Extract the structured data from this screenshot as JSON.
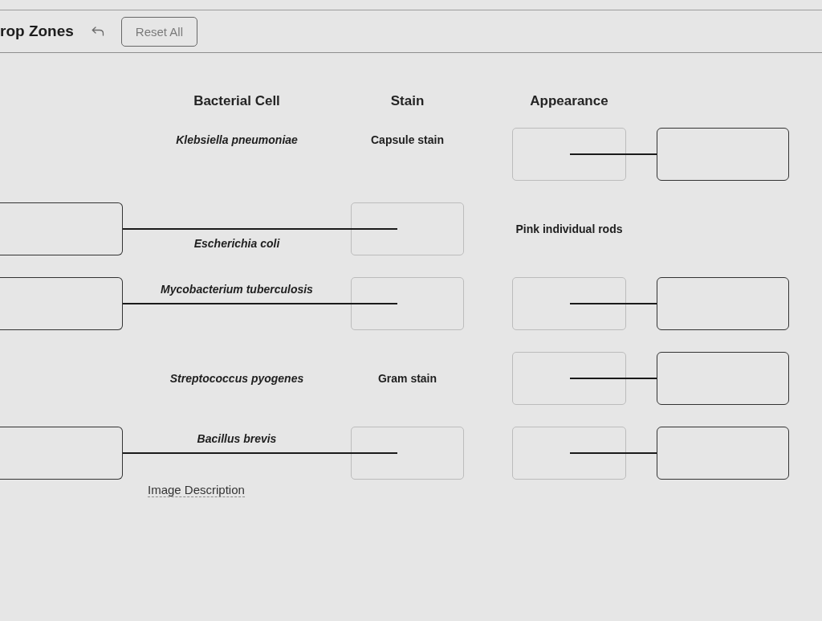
{
  "toolbar": {
    "title": "rop Zones",
    "reset_button": "Reset All"
  },
  "columns": [
    "Bacterial Cell",
    "Stain",
    "Appearance"
  ],
  "rows": [
    {
      "bacterial_cell": "Klebsiella pneumoniae",
      "stain": {
        "kind": "text",
        "text": "Capsule stain"
      },
      "appearance": {
        "kind": "drop"
      }
    },
    {
      "bacterial_cell": "Escherichia coli",
      "stain": {
        "kind": "drop"
      },
      "appearance": {
        "kind": "text",
        "text": "Pink individual rods"
      }
    },
    {
      "bacterial_cell": "Mycobacterium tuberculosis",
      "stain": {
        "kind": "drop"
      },
      "appearance": {
        "kind": "drop"
      }
    },
    {
      "bacterial_cell": "Streptococcus pyogenes",
      "stain": {
        "kind": "text",
        "text": "Gram stain"
      },
      "appearance": {
        "kind": "drop"
      }
    },
    {
      "bacterial_cell": "Bacillus brevis",
      "stain": {
        "kind": "drop"
      },
      "appearance": {
        "kind": "drop"
      }
    }
  ],
  "image_description_link": "Image Description"
}
